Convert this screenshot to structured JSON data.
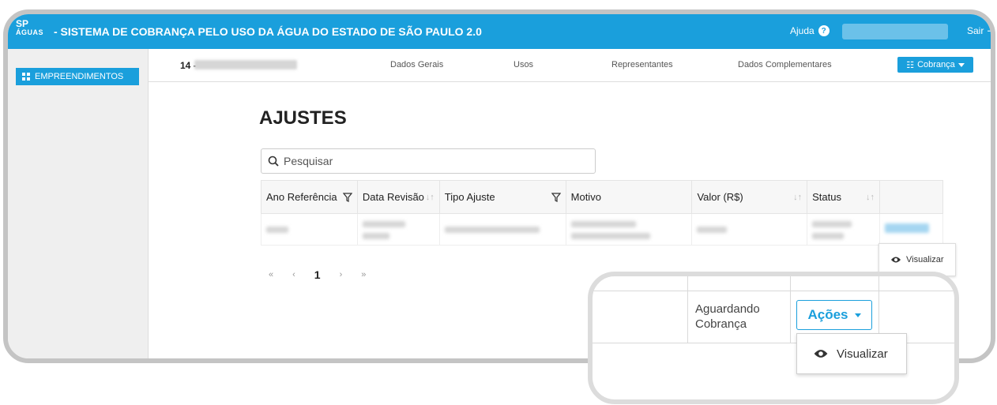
{
  "header": {
    "logo_line1": "SP",
    "logo_line2": "ÁGUAS",
    "title": "- SISTEMA DE COBRANÇA PELO USO DA ÁGUA DO ESTADO DE SÃO PAULO 2.0",
    "help_label": "Ajuda",
    "logout_label": "Sair"
  },
  "sidebar": {
    "items": [
      {
        "label": "EMPREENDIMENTOS",
        "icon": "grid-icon"
      }
    ]
  },
  "subnav": {
    "id_prefix": "14 -",
    "tabs": [
      {
        "label": "Dados Gerais"
      },
      {
        "label": "Usos"
      },
      {
        "label": "Representantes"
      },
      {
        "label": "Dados Complementares"
      }
    ],
    "cobranca_label": "Cobrança"
  },
  "main": {
    "title": "AJUSTES",
    "search": {
      "placeholder": "Pesquisar"
    },
    "table": {
      "columns": [
        {
          "label": "Ano Referência"
        },
        {
          "label": "Data Revisão"
        },
        {
          "label": "Tipo Ajuste"
        },
        {
          "label": "Motivo"
        },
        {
          "label": "Valor (R$)"
        },
        {
          "label": "Status"
        }
      ]
    },
    "pagination": {
      "first": "«",
      "prev": "‹",
      "current": "1",
      "next": "›",
      "last": "»"
    },
    "popup_label": "Visualizar"
  },
  "zoom": {
    "status_line1": "Aguardando",
    "status_line2": "Cobrança",
    "actions_label": "Ações",
    "popup_label": "Visualizar"
  },
  "colors": {
    "primary": "#1a9fdc",
    "frame": "#c4c4c4"
  }
}
